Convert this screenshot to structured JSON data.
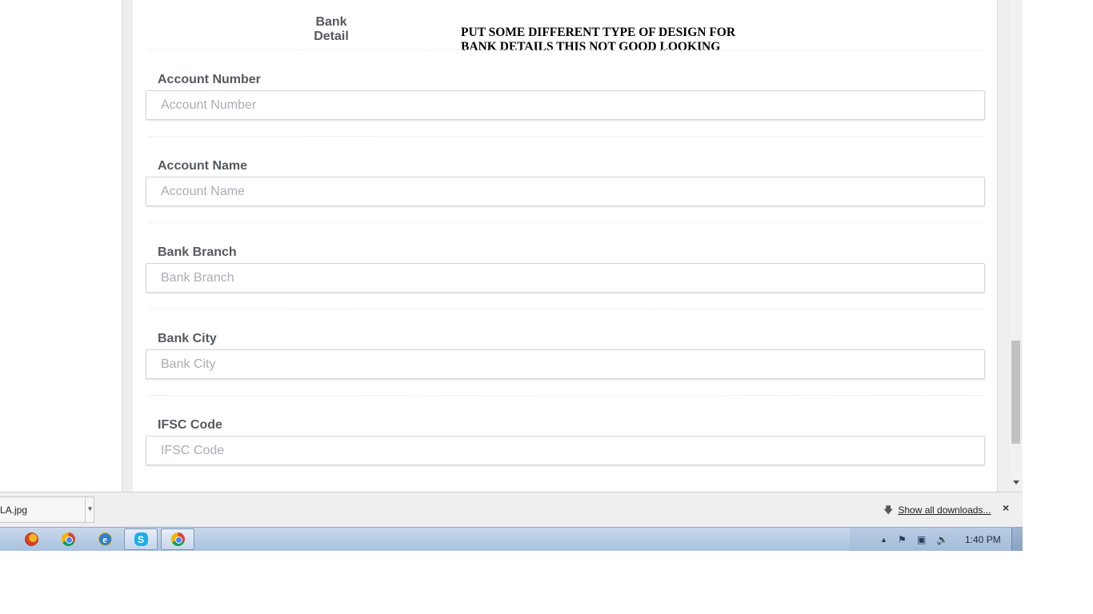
{
  "section": {
    "title": "Bank Detail",
    "annotation": "PUT SOME DIFFERENT TYPE OF DESIGN FOR BANK DETAILS THIS NOT GOOD LOOKING"
  },
  "fields": [
    {
      "label": "Account Number",
      "placeholder": "Account Number",
      "value": ""
    },
    {
      "label": "Account Name",
      "placeholder": "Account Name",
      "value": ""
    },
    {
      "label": "Bank Branch",
      "placeholder": "Bank Branch",
      "value": ""
    },
    {
      "label": "Bank City",
      "placeholder": "Bank City",
      "value": ""
    },
    {
      "label": "IFSC Code",
      "placeholder": "IFSC Code",
      "value": ""
    }
  ],
  "downloads": {
    "item_name": "LA.jpg",
    "show_all": "Show all downloads...",
    "close": "×"
  },
  "taskbar": {
    "apps": [
      {
        "name": "firefox-icon"
      },
      {
        "name": "chrome-icon"
      },
      {
        "name": "internet-explorer-icon"
      },
      {
        "name": "skype-icon",
        "label": "S"
      },
      {
        "name": "chrome-icon"
      }
    ],
    "clock": "1:40 PM"
  },
  "colors": {
    "label": "#555a61",
    "placeholder": "#a9adb5",
    "taskbar": "#a9c2df"
  }
}
